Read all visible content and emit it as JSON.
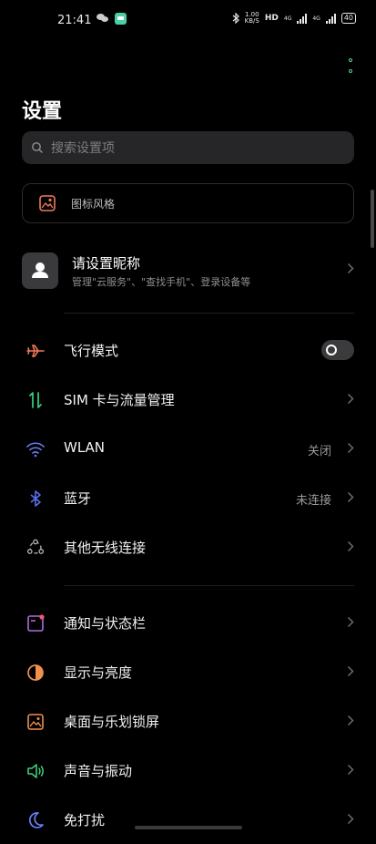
{
  "status_bar": {
    "time": "21:41",
    "speed_value": "1.00",
    "speed_unit": "KB/S",
    "hd_label": "HD",
    "signal_1_label": "4G",
    "signal_2_label": "4G",
    "battery": "40"
  },
  "header": {
    "title": "设置"
  },
  "search": {
    "placeholder": "搜索设置项"
  },
  "theme_card": {
    "label": "图标风格"
  },
  "profile": {
    "name": "请设置昵称",
    "subtitle": "管理\"云服务\"、\"查找手机\"、登录设备等"
  },
  "section1": [
    {
      "label": "飞行模式",
      "icon": "airplane-icon",
      "toggle": "off"
    },
    {
      "label": "SIM 卡与流量管理",
      "icon": "sim-data-icon"
    },
    {
      "label": "WLAN",
      "value": "关闭",
      "icon": "wifi-icon"
    },
    {
      "label": "蓝牙",
      "value": "未连接",
      "icon": "bluetooth-icon"
    },
    {
      "label": "其他无线连接",
      "icon": "wireless-connections-icon"
    }
  ],
  "section2": [
    {
      "label": "通知与状态栏",
      "icon": "notification-icon"
    },
    {
      "label": "显示与亮度",
      "icon": "display-brightness-icon"
    },
    {
      "label": "桌面与乐划锁屏",
      "icon": "desktop-lockscreen-icon"
    },
    {
      "label": "声音与振动",
      "icon": "sound-vibration-icon"
    },
    {
      "label": "免打扰",
      "icon": "do-not-disturb-icon"
    }
  ],
  "colors": {
    "background": "#000000",
    "accent_green": "#4fd18a",
    "airplane": "#f07a5a",
    "sim": "#3ccf7a",
    "wifi": "#6a7cf5",
    "bluetooth": "#5a6ff0",
    "display": "#f0904a"
  }
}
